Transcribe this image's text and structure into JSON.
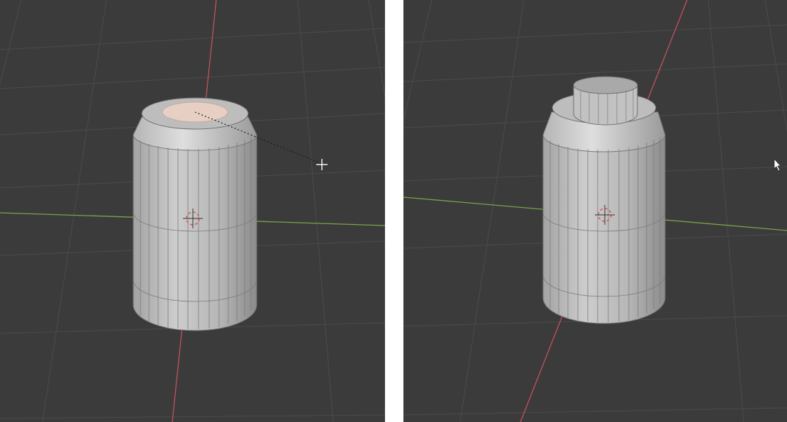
{
  "viewports": [
    {
      "name": "left",
      "state": "inset selected top face",
      "object": "cylinder",
      "selected_face_color": "#e7cfc4"
    },
    {
      "name": "right",
      "state": "extruded neck",
      "object": "bottle"
    }
  ],
  "colors": {
    "viewport_background": "#3b3b3b",
    "grid_line": "#4a4a4a",
    "x_axis": "#c4505f",
    "y_axis": "#7aa34a",
    "mesh_light": "#c9c9c9",
    "mesh_mid": "#a9a9a9",
    "mesh_dark": "#8c8c8c",
    "edge": "#6f6f6f"
  },
  "icons": [
    "3d-cursor-icon",
    "transform-crosshair-icon",
    "mouse-pointer-icon"
  ]
}
